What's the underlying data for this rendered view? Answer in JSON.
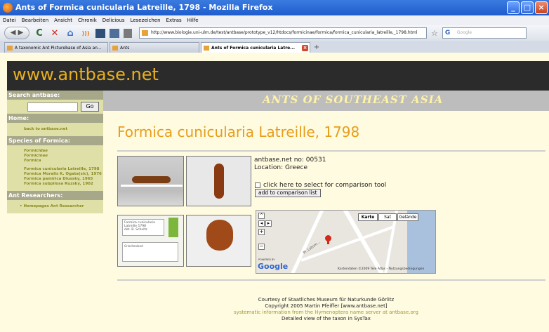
{
  "window": {
    "title": "Ants of Formica cunicularia Latreille, 1798 - Mozilla Firefox",
    "buttons": [
      "_",
      "□",
      "×"
    ]
  },
  "menubar": [
    "Datei",
    "Bearbeiten",
    "Ansicht",
    "Chronik",
    "Delicious",
    "Lesezeichen",
    "Extras",
    "Hilfe"
  ],
  "navbar": {
    "url": "http://www.biologie.uni-ulm.de/test/antbase/prototype_v12/htdocs/formicinae/formica/formica_cunicularia_latreille,_1798.html",
    "search_placeholder": "Google",
    "reload": "C",
    "stop": "✕",
    "home": "⌂",
    "rss": ")))",
    "star": "☆"
  },
  "tabs": [
    {
      "label": "A taxonomic Ant Picturebase of Asia an..."
    },
    {
      "label": "Ants"
    },
    {
      "label": "Ants of Formica cunicularia Latre...",
      "active": true
    }
  ],
  "site": {
    "title": "www.antbase.net",
    "banner": "ANTS OF SOUTHEAST ASIA"
  },
  "sidebar": {
    "search_heading": "Search antbase:",
    "go": "Go",
    "home_heading": "Home:",
    "back_link": "back to antbase.net",
    "species_heading": "Species of Formica:",
    "taxa_links": [
      "Formicidae",
      "Formicinae",
      "Formica"
    ],
    "species_links": [
      "Formica cunicularia Latreille, 1798",
      "Formica Moralis K. Ogata(sic), 1976",
      "Formica pamirica Dlussky, 1965",
      "Formica subpilosa Ruzsky, 1902"
    ],
    "researchers_heading": "Ant Researchers:",
    "researchers_link": "Homepages Ant Researcher"
  },
  "main": {
    "species_title": "Formica cunicularia Latreille, 1798",
    "antbase_no": "antbase.net no: 00531",
    "location": "Location: Greece",
    "compare_label": "click here to select for comparison tool",
    "add_button": "add to comparison list",
    "label_text": "Formica cunicularia Latreille 1798",
    "label_sub": "det. B. Schultz",
    "label_locality": "Griechenland"
  },
  "map": {
    "types": [
      "Karte",
      "Sat",
      "Gelände"
    ],
    "zoom_in": "+",
    "zoom_out": "−",
    "powered": "POWERED BY",
    "google": "Google",
    "copyright": "Kartendaten ©2009 Tele Atlas - Nutzungsbedingungen",
    "road_label": "Pl. Latom..."
  },
  "footer": {
    "line1": "Courtesy of Staatliches Museum für Naturkunde Görlitz",
    "line2": "Copyright 2005 Martin Pfeiffer [www.antbase.net]",
    "line3": "systematic information from the Hymenoptera name server at antbase.org",
    "line4": "Detailed view of the taxon in SysTax"
  }
}
